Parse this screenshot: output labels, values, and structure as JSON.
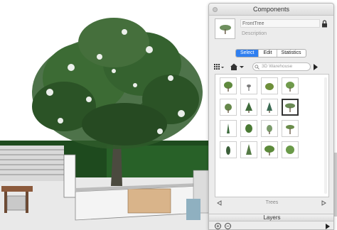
{
  "panel": {
    "title": "Components",
    "component_name": "FrontTree",
    "component_description": "Description",
    "tabs": [
      {
        "label": "Select",
        "active": true
      },
      {
        "label": "Edit",
        "active": false
      },
      {
        "label": "Statistics",
        "active": false
      }
    ],
    "search_placeholder": "3D Warehouse",
    "collection_label": "Trees",
    "selected_cell_index": 7,
    "thumbnail_count": 16
  },
  "layers": {
    "title": "Layers"
  },
  "icons": {
    "close": "close-icon",
    "lock": "lock-icon",
    "view_options": "grid-view-icon",
    "home": "home-icon",
    "dropdown": "chevron-down-icon",
    "search": "search-icon",
    "go": "arrow-right-icon",
    "back": "back-icon",
    "forward": "forward-icon",
    "add_layer": "add-icon",
    "remove_layer": "remove-icon"
  },
  "colors": {
    "accent": "#2f7ff0",
    "panel_bg": "#ececec",
    "foliage": "#2f5a2a",
    "hedge": "#1e4a1e"
  }
}
